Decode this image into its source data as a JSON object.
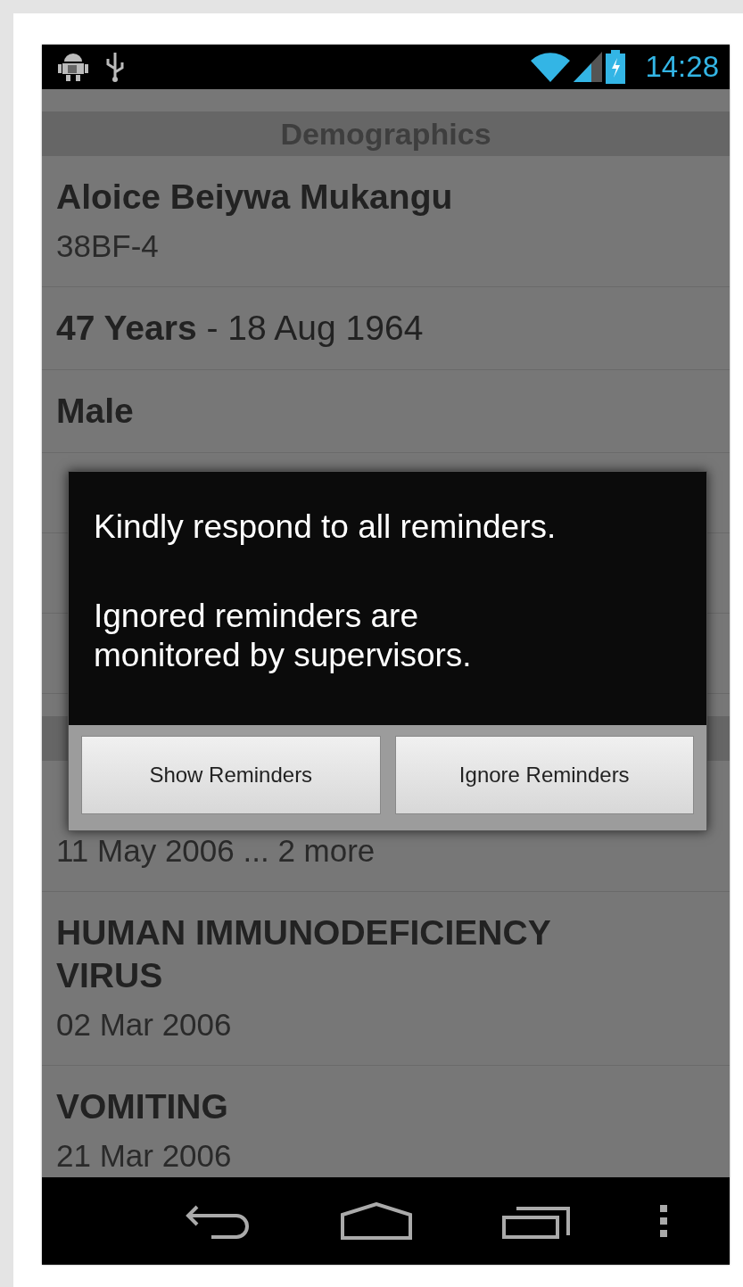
{
  "status_bar": {
    "time": "14:28"
  },
  "list": [
    {
      "kind": "header",
      "title": "Demographics"
    },
    {
      "kind": "item",
      "title": "Aloice Beiywa Mukangu",
      "subtitle": "38BF-4"
    },
    {
      "kind": "mixed",
      "text": "**47 Years** - 18 Aug 1964"
    },
    {
      "kind": "item",
      "title": "Male"
    },
    {
      "kind": "item"
    },
    {
      "kind": "item"
    },
    {
      "kind": "item"
    },
    {
      "kind": "header"
    },
    {
      "kind": "item",
      "subtitle": "11 May 2006 ... 2 more"
    },
    {
      "kind": "item",
      "title": "HUMAN IMMUNODEFICIENCY VIRUS",
      "subtitle": "02 Mar 2006"
    },
    {
      "kind": "item",
      "title": "VOMITING",
      "subtitle": "21 Mar 2006"
    }
  ],
  "dialog": {
    "messages": [
      "Kindly respond to all reminders.",
      "Ignored reminders are monitored by supervisors."
    ],
    "buttons": [
      "Show Reminders",
      "Ignore Reminders"
    ]
  }
}
